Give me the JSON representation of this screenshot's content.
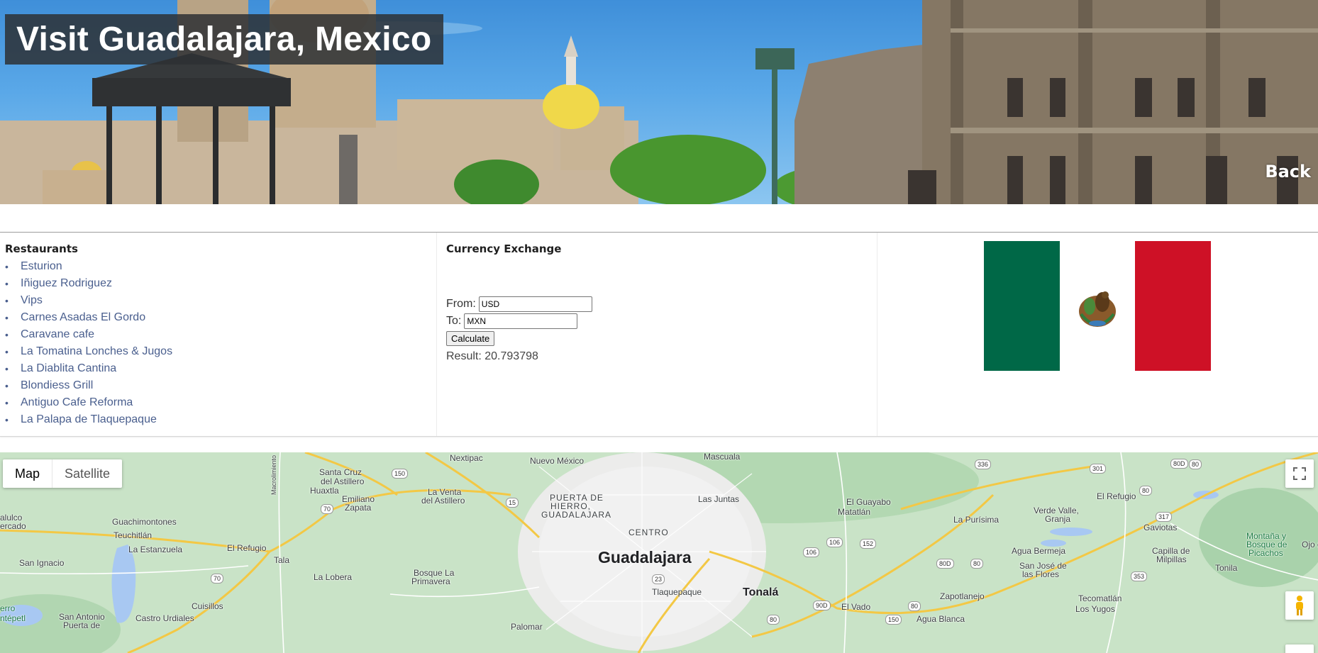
{
  "header": {
    "title": "Visit Guadalajara, Mexico",
    "back_label": "Back"
  },
  "restaurants": {
    "title": "Restaurants",
    "items": [
      "Esturion",
      "Iñiguez Rodriguez",
      "Vips",
      "Carnes Asadas El Gordo",
      "Caravane cafe",
      "La Tomatina Lonches & Jugos",
      "La Diablita Cantina",
      "Blondiess Grill",
      "Antiguo Cafe Reforma",
      "La Palapa de Tlaquepaque"
    ],
    "bullet": "•"
  },
  "currency": {
    "title": "Currency Exchange",
    "from_label": "From:",
    "from_value": "USD",
    "to_label": "To:",
    "to_value": "MXN",
    "calculate_label": "Calculate",
    "result_label": "Result:",
    "result_value": "20.793798"
  },
  "flag": {
    "colors": {
      "green": "#006847",
      "white": "#ffffff",
      "red": "#ce1126"
    }
  },
  "map": {
    "type_buttons": [
      "Map",
      "Satellite"
    ],
    "active_type": "Map",
    "labels": {
      "nextipac": "Nextipac",
      "nuevo_mexico": "Nuevo México",
      "mascuala": "Mascuala",
      "santa_cruz": "Santa Cruz",
      "del_astillero": "del Astillero",
      "huaxtla": "Huaxtla",
      "la_venta": "La Venta",
      "la_venta2": "del Astillero",
      "emiliano": "Emiliano",
      "zapata": "Zapata",
      "macuspana": "Macrolimiento",
      "puerta1": "PUERTA DE",
      "puerta2": "HIERRO,",
      "puerta3": "GUADALAJARA",
      "las_juntas": "Las Juntas",
      "el_guayabo": "El Guayabo",
      "matatlan": "Matatlán",
      "la_purisima": "La Purísima",
      "verde_valle1": "Verde Valle,",
      "verde_valle2": "Granja",
      "el_refugio_e": "El Refugio",
      "guachimontones": "Guachimontones",
      "teuchitlan": "Teuchitlán",
      "alulco": "alulco",
      "ercado": "ercado",
      "centro": "CENTRO",
      "gaviotas": "Gaviotas",
      "montana1": "Montaña y",
      "montana2": "Bosque de",
      "montana3": "Picachos",
      "ojo": "Ojo d",
      "la_estanzuela": "La Estanzuela",
      "el_refugio_w": "El Refugio",
      "guadalajara": "Guadalajara",
      "agua_bermeja": "Agua Bermeja",
      "capilla1": "Capilla de",
      "capilla2": "Milpillas",
      "san_ignacio": "San Ignacio",
      "tala": "Tala",
      "san_jose1": "San José de",
      "san_jose2": "las Flores",
      "tonila": "Tonila",
      "la_lobera": "La Lobera",
      "bosque1": "Bosque La",
      "bosque2": "Primavera",
      "tlaquepaque": "Tlaquepaque",
      "tonala": "Tonalá",
      "zapotlanejo": "Zapotlanejo",
      "tecomatlan": "Tecomatlán",
      "los_yugos": "Los Yugos",
      "cuisillos": "Cuisillos",
      "el_vado": "El Vado",
      "erro": "erro",
      "ntepetl": "ntépetl",
      "san_antonio1": "San Antonio",
      "san_antonio2": "Puerta de",
      "castro": "Castro Urdiales",
      "agua_blanca": "Agua Blanca",
      "palomar": "Palomar"
    },
    "shields": {
      "s150a": "150",
      "s15": "15",
      "s70a": "70",
      "s70b": "70",
      "s23": "23",
      "s106a": "106",
      "s106b": "106",
      "s152": "152",
      "s336": "336",
      "s301": "301",
      "s80d": "80D",
      "s80a": "80",
      "s80b": "80",
      "s80c": "80",
      "s80d2": "80D",
      "s317": "317",
      "s353": "353",
      "s90d": "90D",
      "s80e": "80",
      "s150b": "150",
      "s80f": "80"
    }
  }
}
